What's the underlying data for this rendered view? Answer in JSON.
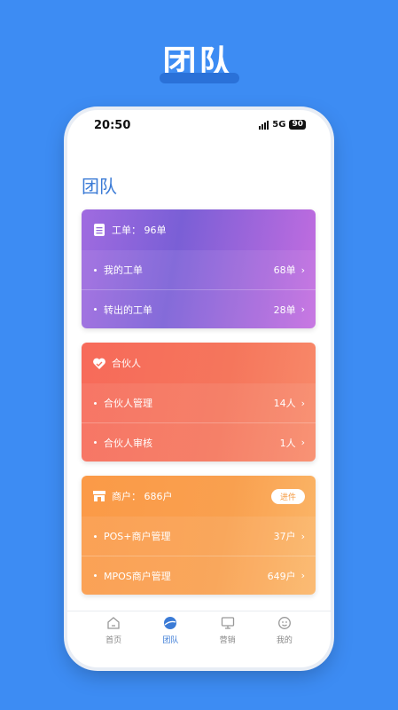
{
  "banner": {
    "title": "团队"
  },
  "status_bar": {
    "time": "20:50",
    "network": "5G",
    "battery": "90"
  },
  "page": {
    "title": "团队"
  },
  "cards": [
    {
      "icon": "document-icon",
      "header": "工单： 96单",
      "rows": [
        {
          "label": "我的工单",
          "value": "68单"
        },
        {
          "label": "转出的工单",
          "value": "28单"
        }
      ]
    },
    {
      "icon": "handshake-heart-icon",
      "header": "合伙人",
      "rows": [
        {
          "label": "合伙人管理",
          "value": "14人"
        },
        {
          "label": "合伙人审核",
          "value": "1人"
        }
      ]
    },
    {
      "icon": "shop-icon",
      "header": "商户：  686户",
      "button": "进件",
      "rows": [
        {
          "label": "POS+商户管理",
          "value": "37户"
        },
        {
          "label": "MPOS商户管理",
          "value": "649户"
        }
      ]
    }
  ],
  "tabbar": [
    {
      "label": "首页",
      "icon": "home-icon",
      "active": false
    },
    {
      "label": "团队",
      "icon": "team-icon",
      "active": true
    },
    {
      "label": "营销",
      "icon": "monitor-icon",
      "active": false
    },
    {
      "label": "我的",
      "icon": "profile-icon",
      "active": false
    }
  ],
  "colors": {
    "background": "#3d8cf3",
    "accent": "#3b7bd6"
  }
}
